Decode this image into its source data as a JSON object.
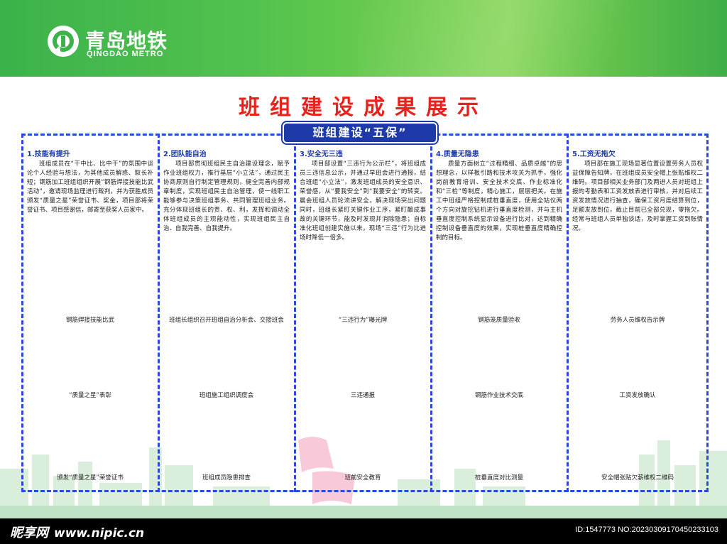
{
  "brand": {
    "name_cn": "青岛地铁",
    "name_en": "QINGDAO METRO",
    "color_primary": "#3bb24a",
    "color_accent_red": "#e8231d",
    "color_border_blue": "#2a4bd7",
    "logo_icon": "qingdao-metro-logo-icon"
  },
  "page": {
    "title": "班组建设成果展示",
    "subtitle": "班组建设“五保”"
  },
  "columns": [
    {
      "heading": "1.技能有提升",
      "body": "班组成员在“干中比、比中干”的氛围中谈论个人经验与想法，为其他成员解惑、取长补短；钢筋加工班组组织开展“钢筋焊接技能比武活动”，邀请现场监理进行裁判，并为获胜成员颁发“质量之星”荣誉证书、奖金，项目部将荣誉证书、项目感谢信，邮寄至获奖人员家中。",
      "captions": [
        "钢筋焊接技能比武",
        "“质量之星”表彰",
        "颁发“质量之星”荣誉证书"
      ]
    },
    {
      "heading": "2.团队能自治",
      "body": "项目部贯彻班组民主自治建设理念，赋予作业班组权力，推行基层“小立法”，通过民主协商原则自行制定管理规则，健全完善内部规章制度，实现班组民主自治管理，使一线职工能够参与决策班组事务、共同管理班组业务。充分体现班组长的责、权、利，发挥和调动全体班组成员的主观能动性，实现班组民主自治、自我完善、自我提升。",
      "captions": [
        "班组长组织召开班组自治分析会、交接班会",
        "班组施工组织调度会",
        "班组成员隐患排查"
      ]
    },
    {
      "heading": "3.安全无三违",
      "body": "项目部设置“三违行为公示栏”，将班组成员三违信息公示，并通过早班会进行通报，结合班组“小立法”，激发班组成员的安全意识、荣誉感，从“要我安全”到“我要安全”的转变。晨会班组人员轮流讲安全，解决现场突出问题同时，班组长紧盯关键作业工序，紧盯酿成事故的关键环节，能及时发现并消除隐患；自标准化班组创建实施以来，现场“三违”行为比进场时降低一倍多。",
      "captions": [
        "“三违行为”曝光牌",
        "三违通报",
        "班前安全教育"
      ]
    },
    {
      "heading": "4.质量无隐患",
      "body": "质量方面树立“过程精细、品质卓越”的思想理念，以样板引路和技术攻关为抓手，强化岗前教育培训、安全技术交底、作业标准化和“三检”等制度，精心施工，层层把关。在施工中班组严格控制成桩垂直度，使用全站仪两个方向对旋挖钻机进行垂直度检测，并与主机垂直度控制系统显示设备进行比对，达到精确控制设备垂直度的效果，实现桩垂直度精确控制的目标。",
      "captions": [
        "钢筋笼质量验收",
        "钢筋作业技术交底",
        "桩垂直度对比测量"
      ]
    },
    {
      "heading": "5.工资无拖欠",
      "body": "项目部在施工现场显著位置设置劳务人员权益保障告知牌，在班组成员安全帽上张贴维权二维码。项目部相关业务部门及两进人员对班组上报的考勤表和工资发放表进行审核，并对后续工资发放情况进行抽查，确保工资月度结算到位，足额发放到位，截止目前已全部兑现，零拖欠。经常与班组人员单独谈话，及时掌握工资到账情况。",
      "captions": [
        "劳务人员维权告示牌",
        "工资发放确认",
        "安全帽张贴欠薪维权二维码"
      ]
    }
  ],
  "watermark": {
    "site": "昵享网",
    "url": "www.nipic.cn",
    "id_text": "ID:1547773 NO:20230309170450233103"
  }
}
